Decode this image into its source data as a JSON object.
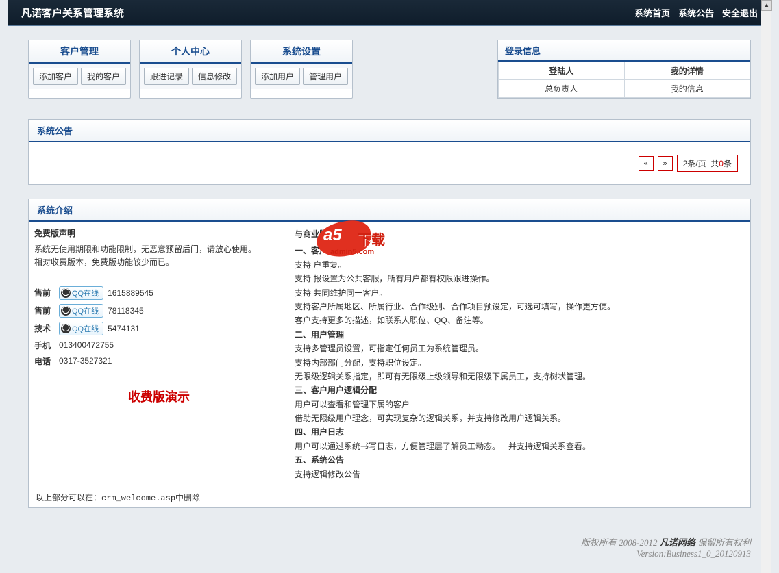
{
  "header": {
    "title": "凡诺客户关系管理系统",
    "nav": [
      "系统首页",
      "系统公告",
      "安全退出"
    ]
  },
  "menuCards": [
    {
      "title": "客户管理",
      "buttons": [
        "添加客户",
        "我的客户"
      ]
    },
    {
      "title": "个人中心",
      "buttons": [
        "跟进记录",
        "信息修改"
      ]
    },
    {
      "title": "系统设置",
      "buttons": [
        "添加用户",
        "管理用户"
      ]
    }
  ],
  "loginInfo": {
    "title": "登录信息",
    "headers": [
      "登陆人",
      "我的详情"
    ],
    "row": [
      "总负责人",
      "我的信息"
    ]
  },
  "announce": {
    "title": "系统公告",
    "pager": {
      "prev": "«",
      "next": "»",
      "perPage": "2条/页",
      "totalLabel": "共",
      "totalCount": "0",
      "totalSuffix": "条"
    }
  },
  "intro": {
    "title": "系统介绍",
    "left": {
      "heading": "免费版声明",
      "line1": "系统无使用期限和功能限制，无恶意预留后门，请放心使用。",
      "line2": "相对收费版本，免费版功能较少而已。",
      "contacts": [
        {
          "label": "售前",
          "qq": "QQ在线",
          "num": "1615889545"
        },
        {
          "label": "售前",
          "qq": "QQ在线",
          "num": "78118345"
        },
        {
          "label": "技术",
          "qq": "QQ在线",
          "num": "5474131"
        }
      ],
      "phone": {
        "label": "手机",
        "num": "013400472755"
      },
      "tel": {
        "label": "电话",
        "num": "0317-3527321"
      },
      "demo": "收费版演示"
    },
    "right": {
      "heading": "与商业版差异",
      "s1t": "一、客户管理",
      "s1l1": "支持                                       户重复。",
      "s1l2": "支持                                       报设置为公共客服，所有用户都有权限跟进操作。",
      "s1l3": "支持                              共同维护同一客户。",
      "s1l4": "支持客户所属地区、所属行业、合作级别、合作项目预设定，可选可填写，操作更方便。",
      "s1l5": "客户支持更多的描述，如联系人职位、QQ、备注等。",
      "s2t": "二、用户管理",
      "s2l1": "支持多管理员设置，可指定任何员工为系统管理员。",
      "s2l2": "支持内部部门分配，支持职位设定。",
      "s2l3": "无限级逻辑关系指定，即可有无限级上级领导和无限级下属员工，支持树状管理。",
      "s3t": "三、客户用户逻辑分配",
      "s3l1": "用户可以查看和管理下属的客户",
      "s3l2": "借助无限级用户理念，可实现复杂的逻辑关系，并支持修改用户逻辑关系。",
      "s4t": "四、用户日志",
      "s4l1": "用户可以通过系统书写日志，方便管理层了解员工动态。一并支持逻辑关系查看。",
      "s5t": "五、系统公告",
      "s5l1": "支持逻辑修改公告"
    },
    "footerNote": "以上部分可以在：crm_welcome.asp中删除"
  },
  "copyright": {
    "line1a": "版权所有 2008-2012 ",
    "brand": "凡诺网络",
    "line1b": " 保留所有权利",
    "line2": "Version:Business1_0_20120913"
  },
  "a5": {
    "text": "a5",
    "dl": "下载",
    "domain": "admin5.com"
  }
}
